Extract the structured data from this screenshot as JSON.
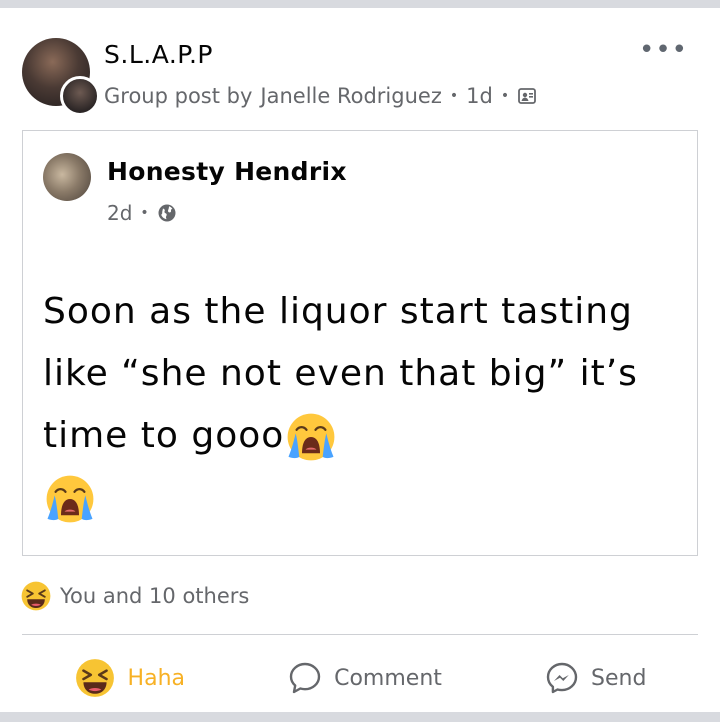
{
  "post": {
    "group_name": "S.L.A.P.P",
    "meta_prefix": "Group post by",
    "author": "Janelle Rodriguez",
    "time": "1d",
    "more_label": "•••"
  },
  "shared": {
    "author": "Honesty Hendrix",
    "time": "2d",
    "text_main": "Soon as the liquor start tasting like “she not even that big” it’s time to gooo"
  },
  "reactions": {
    "summary": "You and 10 others"
  },
  "actions": {
    "haha_label": "Haha",
    "comment_label": "Comment",
    "send_label": "Send"
  },
  "colors": {
    "haha": "#f7b125",
    "muted": "#65676b",
    "divider": "#ced0d4"
  },
  "icons": [
    "more-icon",
    "members-icon",
    "globe-icon",
    "loudly-crying-face-emoji",
    "haha-reaction-icon",
    "comment-icon",
    "messenger-icon"
  ]
}
